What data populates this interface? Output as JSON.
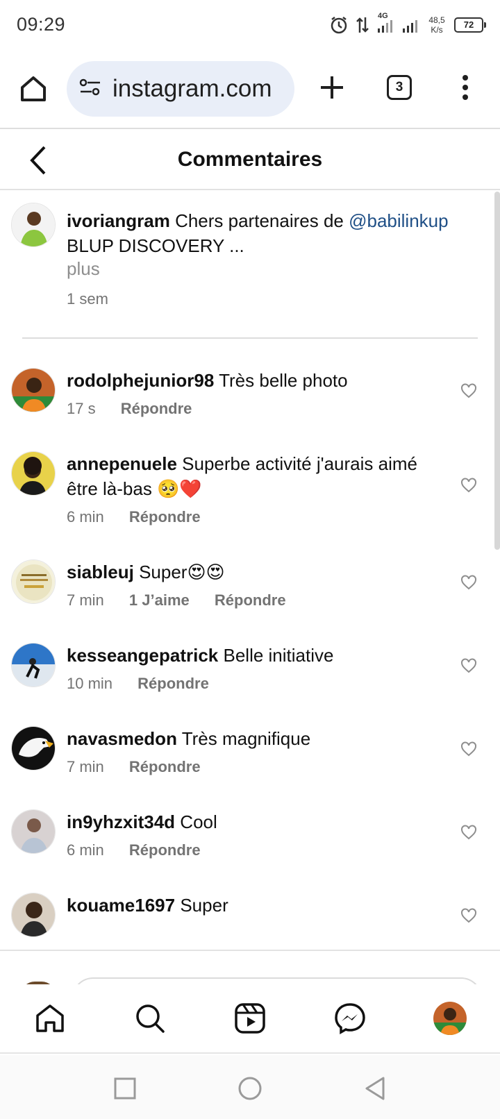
{
  "status": {
    "time": "09:29",
    "network": "4G",
    "speed_value": "48,5",
    "speed_unit": "K/s",
    "battery": "72"
  },
  "browser": {
    "url": "instagram.com",
    "tab_count": "3"
  },
  "header": {
    "title": "Commentaires"
  },
  "caption": {
    "username": "ivoriangram",
    "text": "Chers partenaires de",
    "mention": "@babilinkup",
    "text_line2": "BLUP DISCOVERY ...",
    "more": "plus",
    "time": "1 sem"
  },
  "comments": [
    {
      "username": "rodolphejunior98",
      "text": "Très belle photo",
      "time": "17 s",
      "likes": "",
      "reply": "Répondre"
    },
    {
      "username": "annepenuele",
      "text": "Superbe activité j'aurais aimé être là-bas 🥺❤️",
      "time": "6 min",
      "likes": "",
      "reply": "Répondre"
    },
    {
      "username": "siableuj",
      "text": "Super😍😍",
      "time": "7 min",
      "likes": "1 J’aime",
      "reply": "Répondre"
    },
    {
      "username": "kesseangepatrick",
      "text": "Belle initiative",
      "time": "10 min",
      "likes": "",
      "reply": "Répondre"
    },
    {
      "username": "navasmedon",
      "text": "Très magnifique",
      "time": "7 min",
      "likes": "",
      "reply": "Répondre"
    },
    {
      "username": "in9yhzxit34d",
      "text": "Cool",
      "time": "6 min",
      "likes": "",
      "reply": "Répondre"
    },
    {
      "username": "kouame1697",
      "text": "Super",
      "time": "",
      "likes": "",
      "reply": ""
    }
  ],
  "icons": {
    "home": "home-icon",
    "search": "search-icon",
    "reels": "reels-icon",
    "messenger": "messenger-icon",
    "heart": "heart-icon"
  },
  "colors": {
    "mention": "#1f4f86",
    "muted": "#737373",
    "url_pill": "#e9eef8"
  }
}
